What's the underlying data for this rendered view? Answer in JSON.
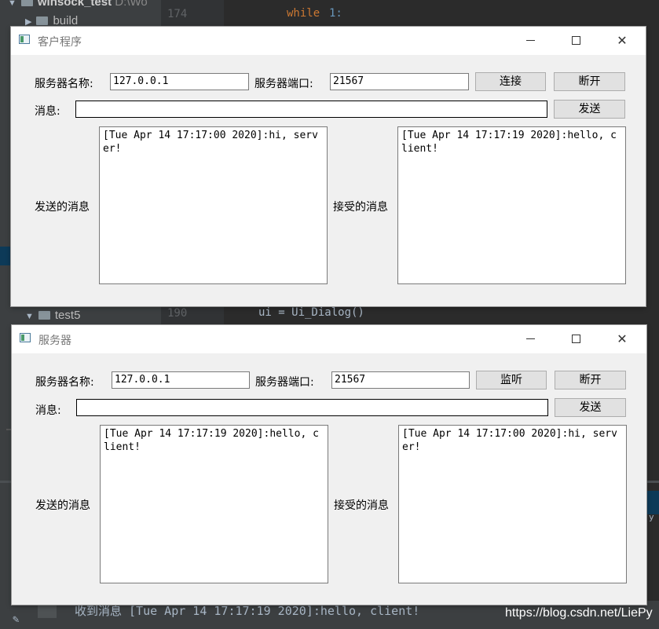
{
  "ide": {
    "project_name": "winsock_test",
    "project_path": "D:\\Wo",
    "folder_build": "build",
    "folder_test5": "test5",
    "line_174": "174",
    "line_190": "190",
    "code_while": "while",
    "code_one": "1:",
    "code_ui": "ui = Ui_Dialog()",
    "bottom_text": "收到消息 [Tue Apr 14 17:17:19 2020]:hello, client!",
    "watermark": "https://blog.csdn.net/LiePy",
    "right_fragment": "y"
  },
  "client": {
    "title": "客户程序",
    "server_name_label": "服务器名称:",
    "server_name_value": "127.0.0.1",
    "server_port_label": "服务器端口:",
    "server_port_value": "21567",
    "connect_button": "连接",
    "disconnect_button": "断开",
    "message_label": "消息:",
    "message_value": "",
    "send_button": "发送",
    "sent_label": "发送的消息",
    "sent_text": "[Tue Apr 14 17:17:00 2020]:hi, server!",
    "received_label": "接受的消息",
    "received_text": "[Tue Apr 14 17:17:19 2020]:hello, client!"
  },
  "server": {
    "title": "服务器",
    "server_name_label": "服务器名称:",
    "server_name_value": "127.0.0.1",
    "server_port_label": "服务器端口:",
    "server_port_value": "21567",
    "listen_button": "监听",
    "disconnect_button": "断开",
    "message_label": "消息:",
    "message_value": "",
    "send_button": "发送",
    "sent_label": "发送的消息",
    "sent_text": "[Tue Apr 14 17:17:19 2020]:hello, client!",
    "received_label": "接受的消息",
    "received_text": "[Tue Apr 14 17:17:00 2020]:hi, server!"
  },
  "colors": {
    "keyword": "#cc7832",
    "number": "#6897bb",
    "code": "#a9b7c6"
  }
}
